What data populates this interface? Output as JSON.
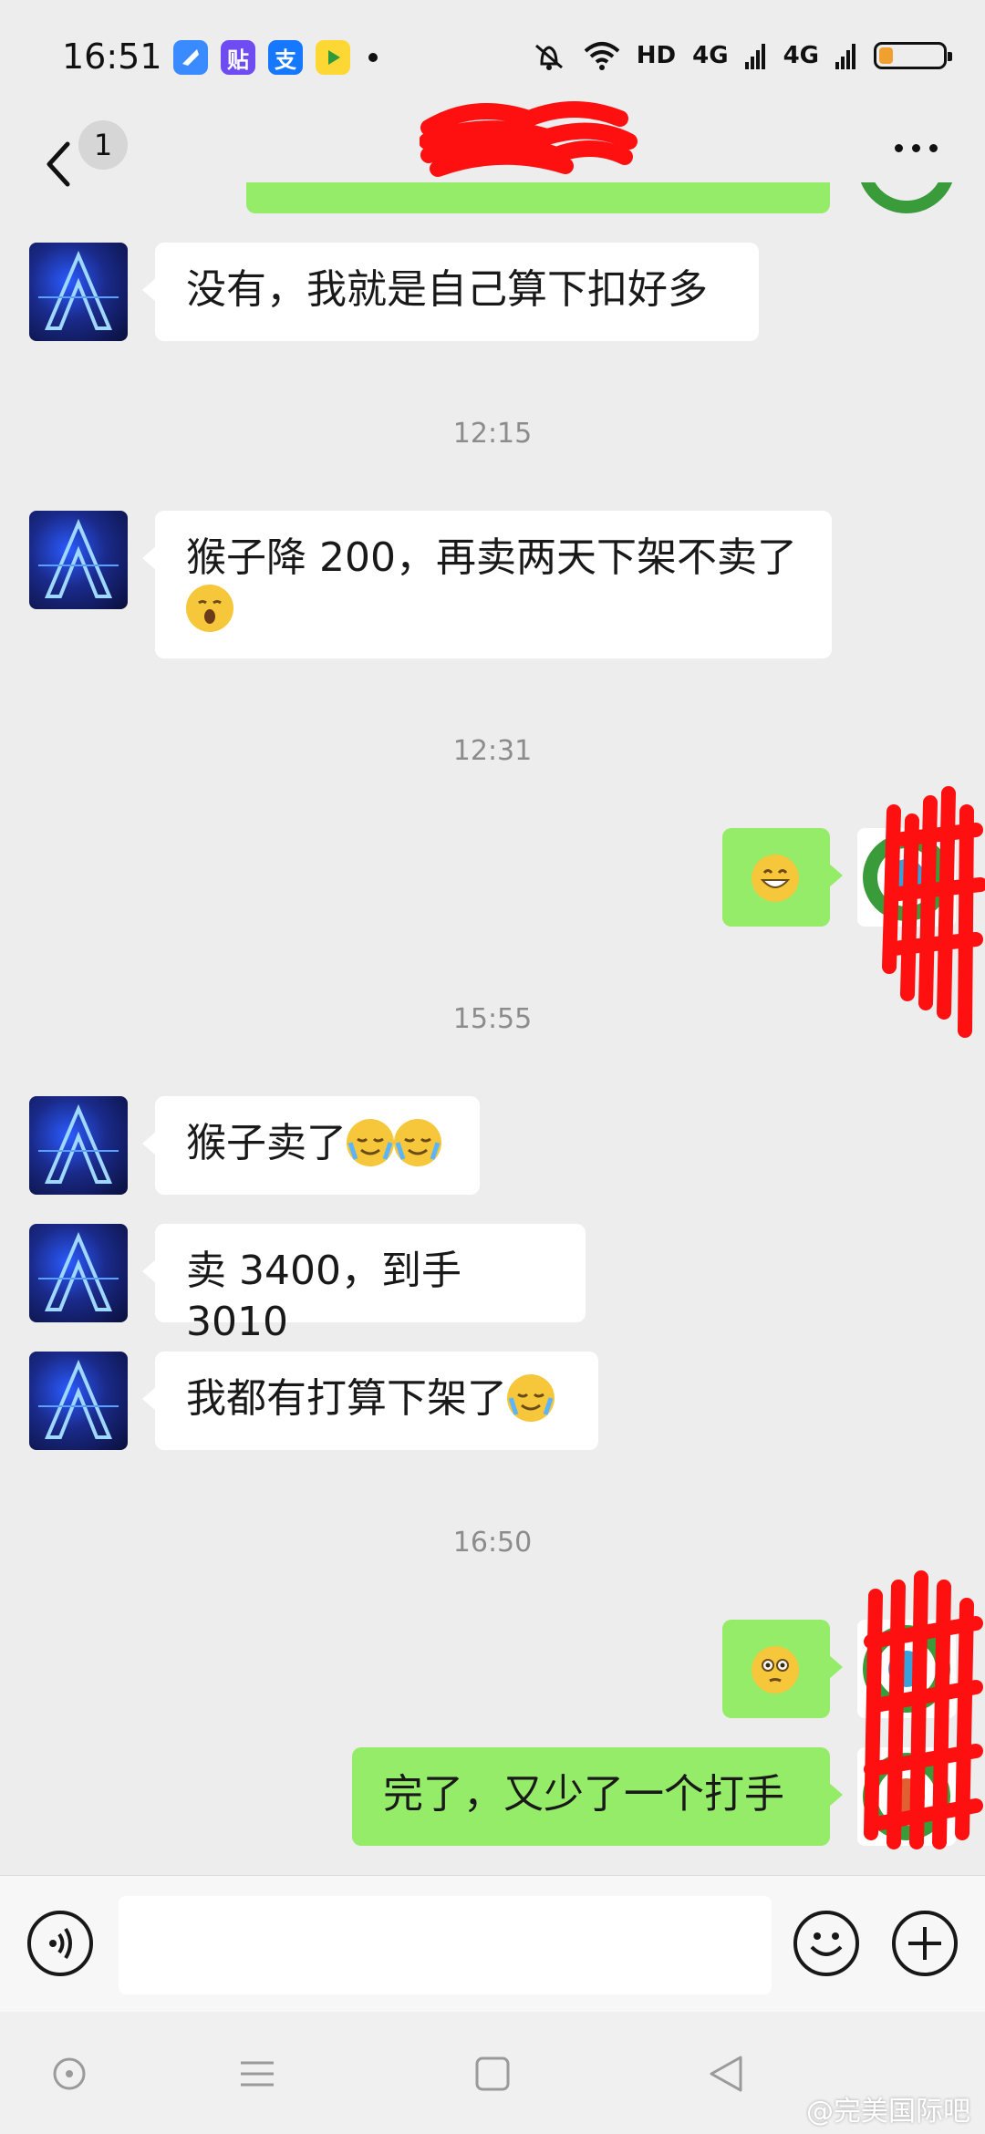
{
  "status_bar": {
    "time": "16:51",
    "hd_label": "HD",
    "signal_1": "4G",
    "signal_2": "4G",
    "app_icons": [
      "blue-app-icon",
      "tieba-icon",
      "alipay-icon",
      "game-center-icon"
    ],
    "app_icon_glyphs": [
      "",
      "贴",
      "支",
      ""
    ],
    "battery_level": 0.2
  },
  "header": {
    "unread_count": "1",
    "title": "",
    "title_redacted": true
  },
  "messages": [
    {
      "side": "left",
      "text": "没有，我就是自己算下扣好多"
    },
    {
      "type": "time",
      "text": "12:15"
    },
    {
      "side": "left",
      "text": "猴子降 200，再卖两天下架不卖了",
      "emoji": "yawning-face"
    },
    {
      "type": "time",
      "text": "12:31"
    },
    {
      "side": "right",
      "emoji": "grinning-face"
    },
    {
      "type": "time",
      "text": "15:55"
    },
    {
      "side": "left",
      "text": "猴子卖了",
      "emoji": "loudly-crying-face"
    },
    {
      "side": "left",
      "text": "卖 3400，到手 3010"
    },
    {
      "side": "left",
      "text": "我都有打算下架了",
      "emoji": "loudly-crying-face"
    },
    {
      "type": "time",
      "text": "16:50"
    },
    {
      "side": "right",
      "emoji": "flushed-face"
    },
    {
      "side": "right",
      "text": "完了，又少了一个打手"
    }
  ],
  "input_bar": {
    "placeholder": ""
  },
  "watermark": "@完美国际吧",
  "colors": {
    "background": "#ededed",
    "bubble_self": "#95ec69",
    "bubble_other": "#ffffff",
    "redaction": "#ff0000"
  }
}
